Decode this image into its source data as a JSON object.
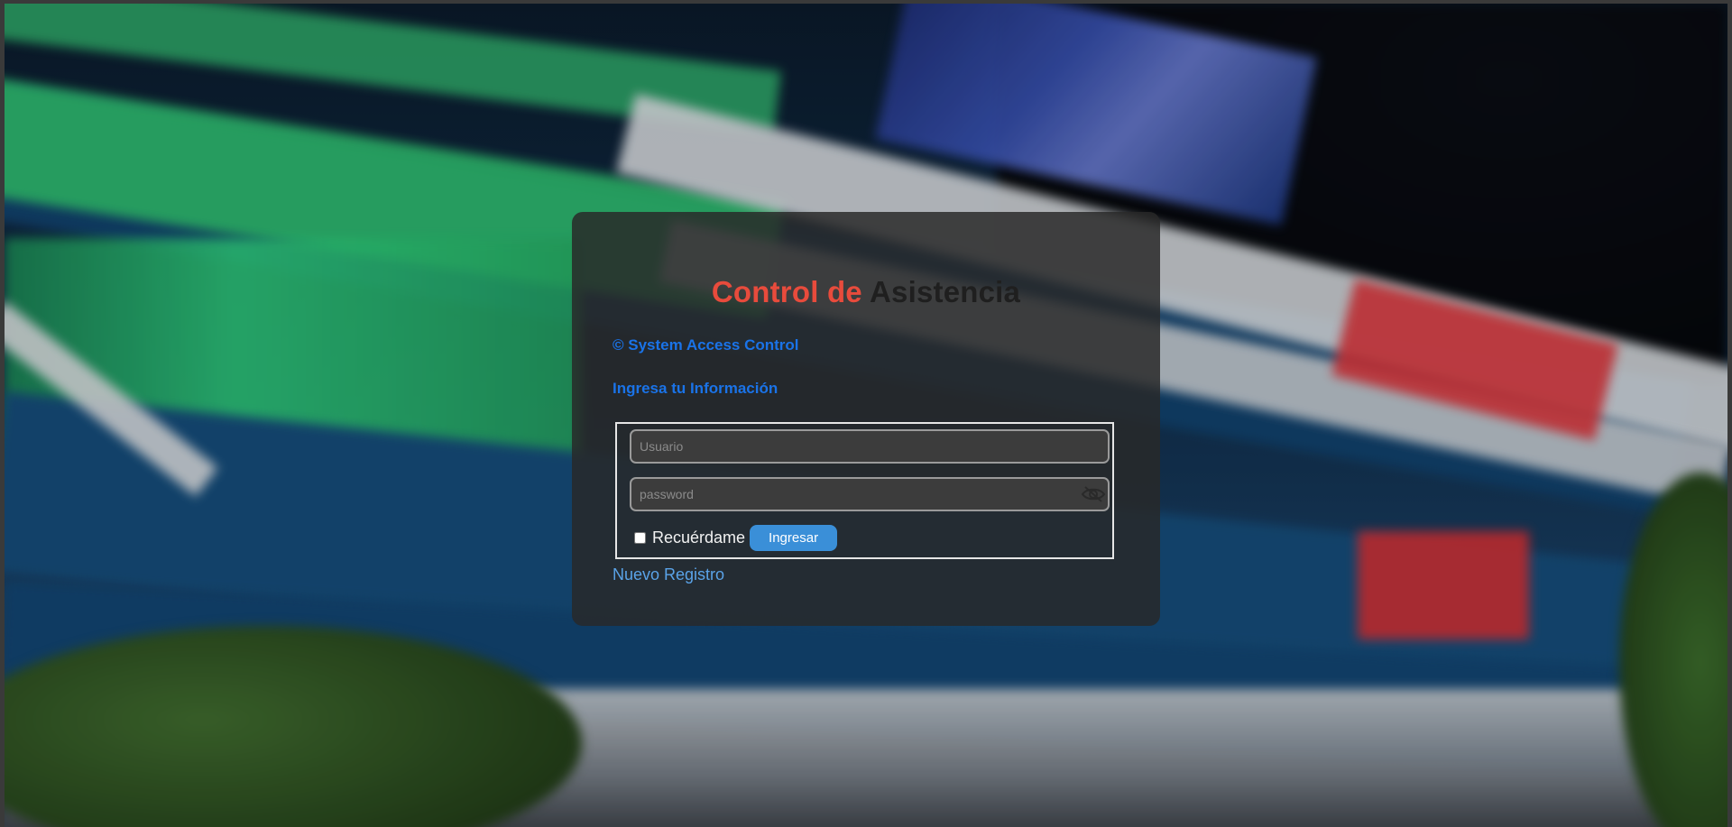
{
  "login": {
    "title_part1": "Control de",
    "title_part2": "Asistencia",
    "brand": "© System Access Control",
    "subtitle": "Ingresa tu Información",
    "username_placeholder": "Usuario",
    "password_placeholder": "password",
    "remember_label": "Recuérdame",
    "remember_checked": false,
    "submit_label": "Ingresar",
    "register_link": "Nuevo Registro",
    "password_toggle_icon": "eye-slash-icon"
  },
  "colors": {
    "title_red": "#e84b3c",
    "title_dark": "#1f1f1f",
    "link_blue": "#1a73e8",
    "button_blue": "#3a8fd8",
    "card_bg": "rgba(40,40,40,0.84)"
  }
}
